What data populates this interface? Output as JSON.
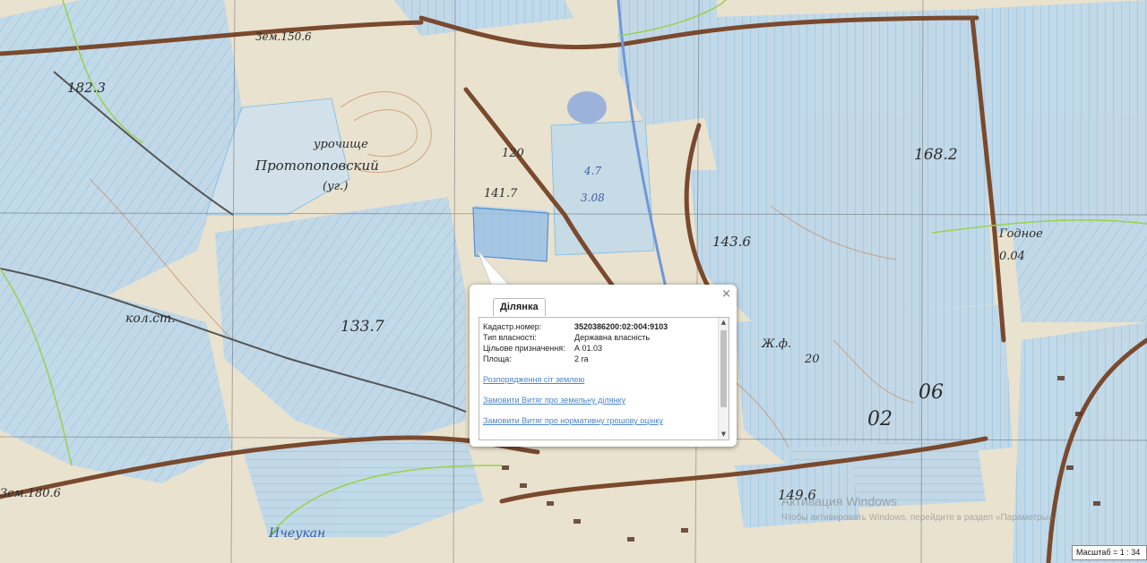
{
  "popup": {
    "tab_label": "Ділянка",
    "close_symbol": "×",
    "rows": [
      {
        "label": "Кадастр.номер:",
        "value": "3520386200:02:004:9103"
      },
      {
        "label": "Тип власності:",
        "value": "Державна власність"
      },
      {
        "label": "Цільове призначення:",
        "value": "А 01.03"
      },
      {
        "label": "Площа:",
        "value": "2 га"
      }
    ],
    "links": [
      "Розпорядження сіт землею",
      "Замовити Витяг про земельну ділянку",
      "Замовити Витяг про нормативну грошову оцінку"
    ]
  },
  "map_labels": {
    "elev_182_3": "182.3",
    "zem_150_6": "Зем.150.6",
    "uroch": "урочище",
    "protopop": "Протопоповский",
    "yu": "(уг.)",
    "n_120": "120",
    "n_141_7": "141.7",
    "n_4_7": "4.7",
    "n_3_08": "3.08",
    "n_133_7": "133.7",
    "n_168_2": "168.2",
    "n_143_6": "143.6",
    "godnoe": "Годное",
    "godnoe_val": "0.04",
    "n_149_6": "149.6",
    "zem_180_6": "Зем.180.6",
    "kol_st": "кол.ст.",
    "zh_f": "Ж.ф.",
    "n_20": "20",
    "n_02": "02",
    "n_06": "06",
    "isp": "Ичеукан"
  },
  "watermark": {
    "line1": "Активация Windows",
    "line2": "Чтобы активировать Windows, перейдите в раздел «Параметры»."
  },
  "scale": "Масштаб = 1 : 34",
  "colors": {
    "map_bg": "#e9e2cf",
    "parcel_fill": "#bfd8ea",
    "parcel_stroke": "#6fb8e8",
    "boundary": "#9ad14a",
    "road": "#7a4a2e",
    "link": "#4a86c8"
  }
}
